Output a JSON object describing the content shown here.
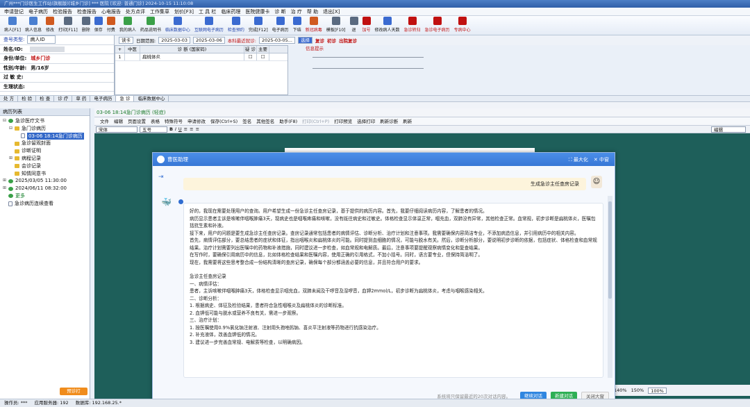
{
  "titlebar": {
    "text": "广州***门诊医生工作站(旗舰版)[城乡门诊] *** 医院 [欢迎: 普通门诊]  2024-10-15 11:10:08"
  },
  "menu": [
    "申请登记",
    "电子病历",
    "检验报告",
    "检查报告",
    "心电报告",
    "处方点评",
    "工作集草",
    "划价[F3]",
    "工 具 栏",
    "临床药理",
    "医院健康卡",
    "诊 断",
    "治 疗",
    "帮 助",
    "退出[X]"
  ],
  "toolbar": [
    {
      "label": "病人[F1]",
      "color": "#4a7fd0"
    },
    {
      "label": "病人信息",
      "color": "#4a7fd0"
    },
    {
      "label": "修改",
      "color": "#d05a20"
    },
    {
      "label": "打印[F11]",
      "color": "#5a6a80"
    },
    {
      "label": "删除",
      "color": "#5a6a80"
    },
    {
      "label": "保存",
      "color": "#3a6ad0"
    },
    {
      "label": "付费",
      "color": "#d05a20"
    },
    {
      "label": "我的病人",
      "color": "#3aa048"
    },
    {
      "label": "药品说明书",
      "color": "#3aa048"
    },
    {
      "label": "临床数据中心",
      "color": "#3a6ad0",
      "style": "blue"
    },
    {
      "label": "互联网电子病历",
      "color": "#3a6ad0",
      "style": "blue"
    },
    {
      "label": "检查预约",
      "color": "#3a6ad0",
      "style": "blue"
    },
    {
      "label": "完成[F12]",
      "color": "#3a6ad0"
    },
    {
      "label": "电子病历",
      "color": "#3a6ad0"
    },
    {
      "label": "下结",
      "color": "#3a6ad0"
    },
    {
      "label": "新冠病毒",
      "color": "#d05a20",
      "style": "red"
    },
    {
      "label": "模板[F10]",
      "color": "#5a6a80"
    },
    {
      "label": "退",
      "color": "#5a6a80"
    },
    {
      "label": "加号",
      "color": "#c01010",
      "style": "red"
    },
    {
      "label": "修改病人天数",
      "color": "#3a6ad0"
    },
    {
      "label": "急诊转归",
      "color": "#c01010",
      "style": "red"
    },
    {
      "label": "急诊电子病历",
      "color": "#c01010",
      "style": "red"
    },
    {
      "label": "专病中心",
      "color": "#c01010",
      "style": "red"
    }
  ],
  "patient": {
    "card_label": "查号类型:",
    "card_type": "病人ID",
    "name_label": "姓名/ID:",
    "unit_label": "身份/单位:",
    "unit_value": "城乡门诊",
    "gender_label": "性别/年龄:",
    "gender_value": "男/16岁",
    "allergy_label": "过 敏 史:",
    "physio_label": "生理状态:"
  },
  "dxbar": {
    "read_btn": "读卡",
    "date_label": "日期范围:",
    "date_from": "2025-03-03",
    "date_to": "2025-03-06",
    "recent_label": "本科最近就诊:",
    "recent_value": "2025-03-05...",
    "pick_btn": "选择",
    "opt1": "复诊",
    "opt2": "初诊",
    "opt3": "出院复诊"
  },
  "dxtable": {
    "headers": [
      "中医",
      "诊 断 (国家码)",
      "疑 诊",
      "主要"
    ],
    "rows": [
      {
        "idx": "1",
        "name": "扁桃体炎"
      }
    ]
  },
  "note": {
    "label": "信息提示"
  },
  "tabs": [
    "处 方",
    "检 验",
    "检 查",
    "诊 疗",
    "草 药",
    "电子病历",
    "急 诊",
    "临床数据中心"
  ],
  "left_panel": {
    "title": "病历列表",
    "tree": [
      {
        "text": "急诊医疗文书",
        "lvl": 0,
        "icon": "pat",
        "exp": "⊟"
      },
      {
        "text": "急门诊病历",
        "lvl": 1,
        "icon": "folder",
        "exp": "⊟"
      },
      {
        "text": "03-06 18:14急门诊病历",
        "lvl": 2,
        "icon": "doc",
        "sel": true
      },
      {
        "text": "急诊留观封面",
        "lvl": 1,
        "icon": "folder"
      },
      {
        "text": "诊断证明",
        "lvl": 1,
        "icon": "folder"
      },
      {
        "text": "病程记录",
        "lvl": 1,
        "icon": "folder",
        "exp": "⊞"
      },
      {
        "text": "会诊记录",
        "lvl": 1,
        "icon": "folder"
      },
      {
        "text": "知情同意书",
        "lvl": 1,
        "icon": "folder"
      },
      {
        "text": "2025/03/05 11:30:00",
        "lvl": 0,
        "icon": "pat",
        "exp": "⊞"
      },
      {
        "text": "2024/06/11 08:32:00",
        "lvl": 0,
        "icon": "pat",
        "exp": "⊞"
      },
      {
        "text": "更多",
        "lvl": 0,
        "icon": "pat",
        "green": true
      },
      {
        "text": "急诊病历连续查看",
        "lvl": 0,
        "icon": "doc"
      }
    ],
    "bottom_btn": "预诊打"
  },
  "editor": {
    "tab": "03-06 18:14急门诊病历 (轻症)",
    "toolbar": [
      "文件",
      "编辑",
      "页面设置",
      "表格",
      "特殊符号",
      "申请修改",
      "保存(Ctrl+S)",
      "签名",
      "其他签名",
      "助手(F8)",
      "打印(Ctrl+P)",
      "打印预览",
      "选择打印",
      "刷新诊断",
      "刷新"
    ],
    "font": "宋体",
    "size": "五号",
    "mode": "编辑",
    "zoom": [
      "140%",
      "150%",
      "100%"
    ]
  },
  "chat": {
    "title": "曹医助理",
    "maximize": "最大化",
    "minimize": "中窗",
    "user_msg": "生成急诊主任查房记录",
    "paragraphs": [
      "好的，我现在需要处理用户的查询。用户希望生成一份急诊主任查房记录，基于提供的病历内容。首先，我要仔细阅读病历内容，了解患者的情况。",
      "病历显示患者主诉是咳嗽伴咽喉肿痛3天，现病史也是咽喉疼痛和咳嗽，没有既往病史和过敏史。体格检查显示体温正常，咽充血，双肺没有异常，其他检查正常。血常规，初步诊断是扁桃体炎，医嘱包括抗生素和补液。",
      "接下来，用户的问题是要生成急诊主任查房记录。查房记录通常包括患者的病情评估、诊断分析、治疗计划和注意事项。我需要确保内容简洁专业，不添加病造信息，并引用病历中的相关内容。",
      "首先，病情评估部分，要总结患者的症状和体征，指出咽喉炎和扁桃体炎的可能。同时提到血细胞的情况，可能与脱水有关。然后，诊断分析部分，要说明初步诊断的依据，包括症状、体格检查和血常规结果。治疗计划需要列出医嘱中的药物和补液措施，同时建议进一步检查，如血常规和电解质。最后，注意事项要提醒观察病情变化和复查结果。",
      "在写作时，要确保引用病历中的信息，比如体格检查结果和医嘱内容，使用正确的引用格式，不加小括号。同时，语言要专业，但保持简洁明了。",
      "现在，我需要将这些思考整合成一份结构清晰的查房记录，确保每个部分都涵盖必要的信息，并且符合用户的要求。"
    ],
    "record": [
      "急诊主任查房记录",
      "一、病情评估：",
      "患者，主诉咳嗽伴咽喉肿痛3天，体格检查显示咽充血，双肺未闻及干啰音及湿啰音，血钾2mmol/L，初步诊断为扁桃体炎，考虑与咽喉感染相关。",
      "二、诊断分析：",
      "1. 根据病史、体征及检验结果，患者符合急性咽喉炎及扁桃体炎的诊断标准。",
      "2. 血钾低可能与脱水或营养不良有关，需进一步观察。",
      "三、治疗计划：",
      "1. 按医嘱使用0.9%氯化钠注射液、注射用头孢唑肟钠、喜炎平注射液等药物进行抗感染治疗。",
      "2. 补充液体，改善血钾低的情况。",
      "3. 建议进一步完善血常规、电解质等检查，以明确病因。"
    ],
    "footer_hint": "系统将只保留最近的20次对话内容。",
    "btn_continue": "继续对话",
    "btn_new": "新建对话",
    "btn_close": "关闭大窗"
  },
  "statusbar": [
    "操作员: ***",
    "应用服务器: 192",
    "数据库: 192.168.25.*"
  ]
}
